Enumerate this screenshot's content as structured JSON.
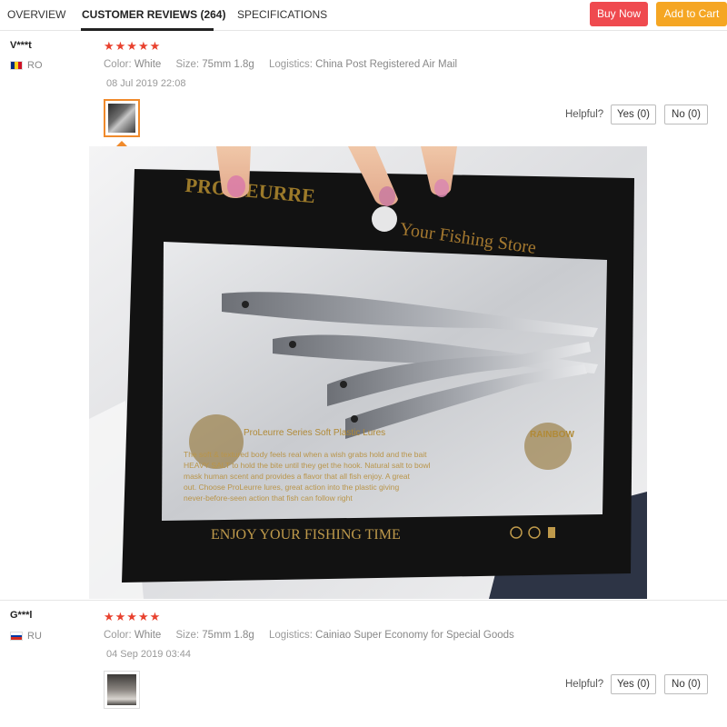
{
  "tabs": {
    "overview": "OVERVIEW",
    "reviews": "CUSTOMER REVIEWS (264)",
    "specifications": "SPECIFICATIONS"
  },
  "actions": {
    "buy_now": "Buy Now",
    "add_to_cart": "Add to Cart"
  },
  "colors": {
    "buy_now": "#ef4a4f",
    "add_to_cart": "#f5a623",
    "stars": "#e8412e",
    "thumb_active": "#f08a2b"
  },
  "reviews": [
    {
      "user": "V***t",
      "country": "RO",
      "flag_icon": "romania-flag-icon",
      "rating": 5,
      "stars": "★★★★★",
      "color_label": "Color:",
      "color_value": "White",
      "size_label": "Size:",
      "size_value": "75mm 1.8g",
      "logistics_label": "Logistics:",
      "logistics_value": "China Post Registered Air Mail",
      "date": "08 Jul 2019 22:08",
      "helpful_label": "Helpful?",
      "yes_label": "Yes (0)",
      "no_label": "No (0)",
      "photo": {
        "brand_text": "PRO LEURRE",
        "store_text": "Your Fishing Store",
        "mid_brand": "ProLeurre Series Soft Plastic Lures",
        "blurb_lines": [
          "The soft & textured body feels real when a wish grabs hold and the bait",
          "HEAVY SALT to hold the bite until they get the hook. Natural salt to bowl",
          "mask human scent and provides a flavor that all fish enjoy. A great",
          "out. Choose ProLeurre lures, great action into the plastic giving",
          "never-before-seen action that fish can follow right"
        ],
        "slogan": "ENJOY YOUR FISHING TIME",
        "rainbow_text": "RAINBOW"
      }
    },
    {
      "user": "G***l",
      "country": "RU",
      "flag_icon": "russia-flag-icon",
      "rating": 5,
      "stars": "★★★★★",
      "color_label": "Color:",
      "color_value": "White",
      "size_label": "Size:",
      "size_value": "75mm 1.8g",
      "logistics_label": "Logistics:",
      "logistics_value": "Cainiao Super Economy for Special Goods",
      "date": "04 Sep 2019 03:44",
      "helpful_label": "Helpful?",
      "yes_label": "Yes (0)",
      "no_label": "No (0)"
    }
  ]
}
